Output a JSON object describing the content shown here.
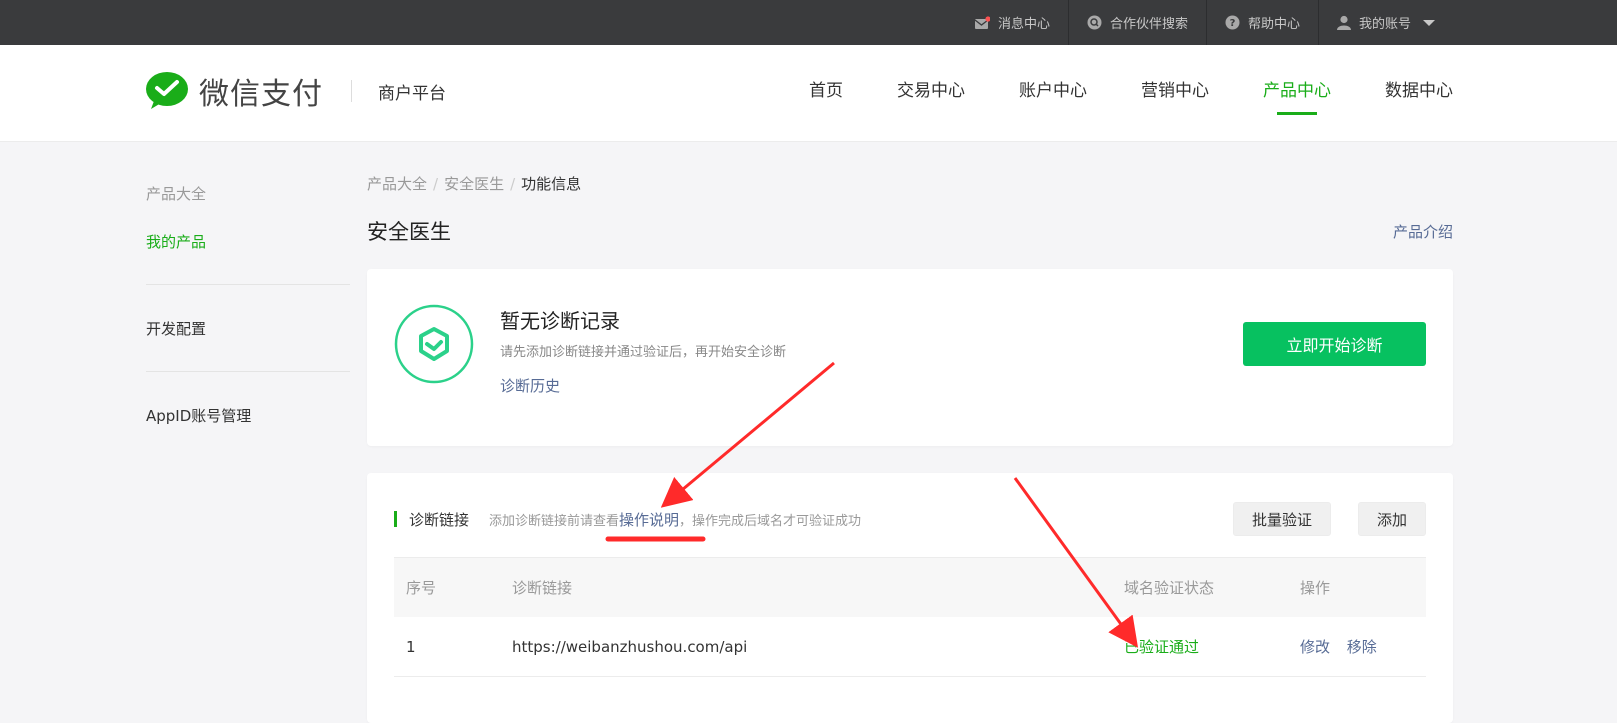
{
  "topbar": {
    "items": [
      {
        "label": "消息中心",
        "icon": "mail-icon"
      },
      {
        "label": "合作伙伴搜索",
        "icon": "search-icon"
      },
      {
        "label": "帮助中心",
        "icon": "help-icon"
      },
      {
        "label": "我的账号",
        "icon": "user-icon"
      }
    ]
  },
  "header": {
    "logo_text": "微信支付",
    "logo_sub": "商户平台",
    "nav": [
      "首页",
      "交易中心",
      "账户中心",
      "营销中心",
      "产品中心",
      "数据中心"
    ],
    "active_nav": "产品中心"
  },
  "sidebar": {
    "items": [
      "产品大全",
      "我的产品",
      "开发配置",
      "AppID账号管理"
    ]
  },
  "breadcrumb": [
    "产品大全",
    "安全医生",
    "功能信息"
  ],
  "page": {
    "title": "安全医生",
    "intro_link": "产品介绍"
  },
  "diagnosis": {
    "title": "暂无诊断记录",
    "desc": "请先添加诊断链接并通过验证后，再开始安全诊断",
    "history_link": "诊断历史",
    "start_button": "立即开始诊断"
  },
  "links_section": {
    "title": "诊断链接",
    "hint_prefix": "添加诊断链接前请查看",
    "hint_link": "操作说明",
    "hint_suffix": "，操作完成后域名才可验证成功",
    "batch_button": "批量验证",
    "add_button": "添加",
    "columns": [
      "序号",
      "诊断链接",
      "域名验证状态",
      "操作"
    ],
    "rows": [
      {
        "no": "1",
        "url": "https://weibanzhushou.com/api",
        "status": "已验证通过",
        "ops": [
          "修改",
          "移除"
        ]
      }
    ]
  },
  "colors": {
    "brand_green": "#1aad19",
    "button_green": "#07c160",
    "link_blue": "#576b95",
    "annotation_red": "#ff2a2a"
  }
}
